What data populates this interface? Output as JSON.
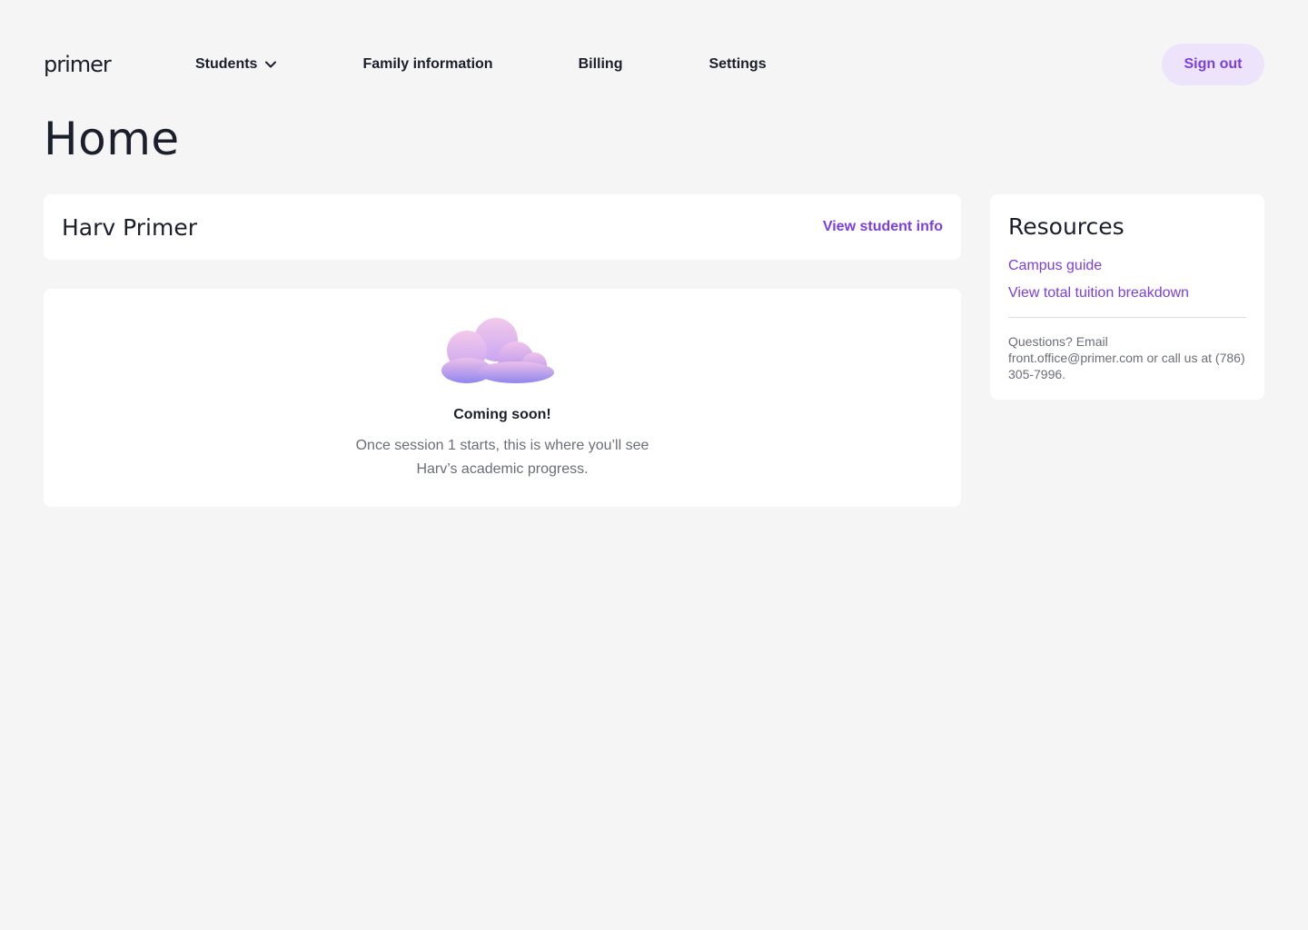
{
  "brand": {
    "logo_text": "primer"
  },
  "nav": {
    "items": [
      {
        "label": "Students",
        "icon": "chevron-down-icon"
      },
      {
        "label": "Family information"
      },
      {
        "label": "Billing"
      },
      {
        "label": "Settings"
      }
    ],
    "sign_out_label": "Sign out"
  },
  "page": {
    "title": "Home"
  },
  "student": {
    "name": "Harv Primer",
    "view_link": "View student info"
  },
  "progress": {
    "illustration": "cloud-illustration",
    "heading": "Coming soon!",
    "description": "Once session 1 starts, this is where you’ll see Harv’s academic progress."
  },
  "resources": {
    "title": "Resources",
    "links": [
      {
        "label": "Campus guide"
      },
      {
        "label": "View total tuition breakdown"
      }
    ],
    "contact": "Questions? Email front.office@primer.com or call us at (786) 305-7996."
  },
  "colors": {
    "background": "#f5f5f5",
    "accent": "#7b3ee0",
    "accent_bg": "#ede4fb",
    "text": "#1b1e2b",
    "muted": "#6b6e78"
  }
}
